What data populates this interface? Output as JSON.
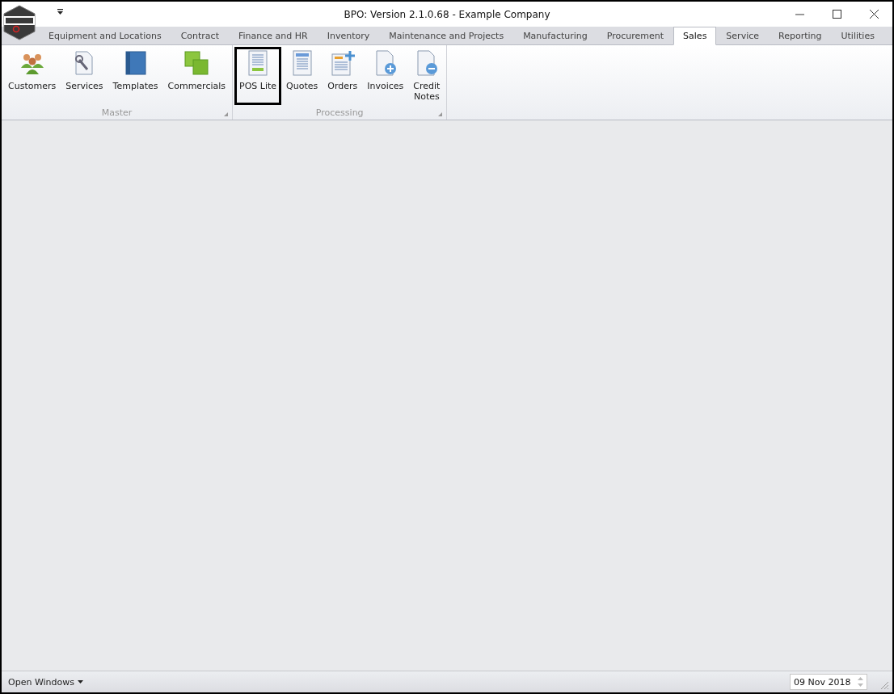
{
  "window": {
    "title": "BPO: Version 2.1.0.68 - Example Company"
  },
  "tabs": [
    {
      "label": "Equipment and Locations",
      "selected": false
    },
    {
      "label": "Contract",
      "selected": false
    },
    {
      "label": "Finance and HR",
      "selected": false
    },
    {
      "label": "Inventory",
      "selected": false
    },
    {
      "label": "Maintenance and Projects",
      "selected": false
    },
    {
      "label": "Manufacturing",
      "selected": false
    },
    {
      "label": "Procurement",
      "selected": false
    },
    {
      "label": "Sales",
      "selected": true
    },
    {
      "label": "Service",
      "selected": false
    },
    {
      "label": "Reporting",
      "selected": false
    },
    {
      "label": "Utilities",
      "selected": false
    }
  ],
  "ribbon_groups": [
    {
      "title": "Master",
      "buttons": [
        {
          "label": "Customers",
          "kind": "people",
          "highlighted": false
        },
        {
          "label": "Services",
          "kind": "wrench",
          "highlighted": false
        },
        {
          "label": "Templates",
          "kind": "book",
          "highlighted": false
        },
        {
          "label": "Commercials",
          "kind": "squares",
          "highlighted": false
        }
      ]
    },
    {
      "title": "Processing",
      "buttons": [
        {
          "label": "POS Lite",
          "kind": "pos",
          "highlighted": true
        },
        {
          "label": "Quotes",
          "kind": "doc",
          "highlighted": false
        },
        {
          "label": "Orders",
          "kind": "orders",
          "highlighted": false
        },
        {
          "label": "Invoices",
          "kind": "plus",
          "highlighted": false
        },
        {
          "label": "Credit\nNotes",
          "kind": "minus",
          "highlighted": false
        }
      ]
    }
  ],
  "status_bar": {
    "open_windows": "Open Windows",
    "date": "09 Nov 2018"
  }
}
